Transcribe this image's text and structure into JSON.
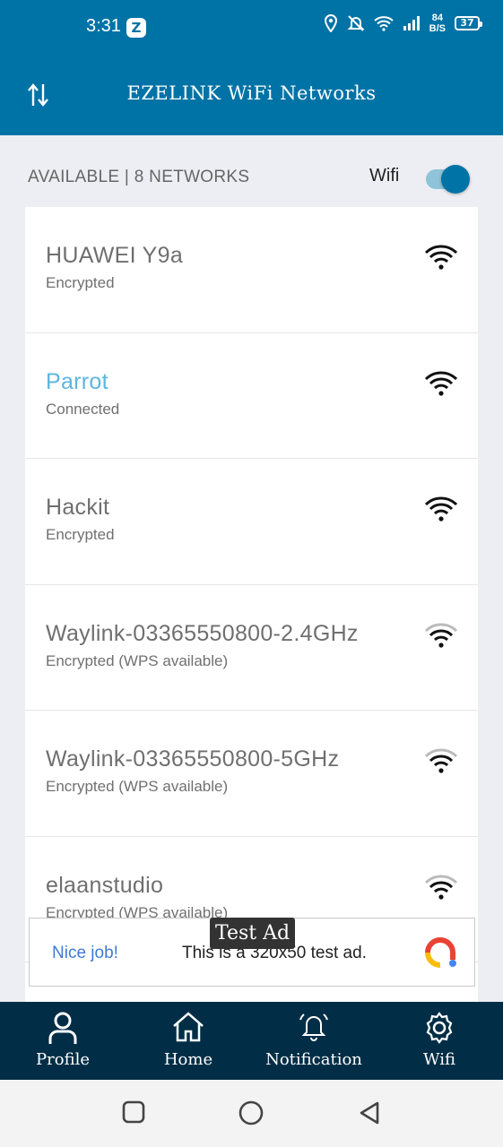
{
  "status_bar": {
    "time": "3:31",
    "app_badge": "Z",
    "speed_value": "84",
    "speed_unit": "B/S",
    "battery": "37"
  },
  "app_bar": {
    "title": "EZELINK WiFi Networks"
  },
  "header": {
    "available_text": "AVAILABLE | 8 NETWORKS",
    "wifi_label": "Wifi",
    "wifi_on": true
  },
  "networks": [
    {
      "name": "HUAWEI Y9a",
      "status": "Encrypted",
      "connected": false,
      "signal_level": 4
    },
    {
      "name": "Parrot",
      "status": "Connected",
      "connected": true,
      "signal_level": 4
    },
    {
      "name": "Hackit",
      "status": "Encrypted",
      "connected": false,
      "signal_level": 4
    },
    {
      "name": "Waylink-03365550800-2.4GHz",
      "status": "Encrypted (WPS available)",
      "connected": false,
      "signal_level": 3
    },
    {
      "name": "Waylink-03365550800-5GHz",
      "status": "Encrypted (WPS available)",
      "connected": false,
      "signal_level": 3
    },
    {
      "name": "elaanstudio",
      "status": "Encrypted (WPS available)",
      "connected": false,
      "signal_level": 3
    }
  ],
  "ad": {
    "badge": "Test Ad",
    "left_text": "Nice job!",
    "message": "This is a 320x50 test ad."
  },
  "bottom_nav": {
    "items": [
      {
        "label": "Profile",
        "icon": "person-icon"
      },
      {
        "label": "Home",
        "icon": "home-icon"
      },
      {
        "label": "Notification",
        "icon": "bell-icon"
      },
      {
        "label": "Wifi",
        "icon": "gear-icon"
      }
    ]
  },
  "colors": {
    "primary": "#0073a6",
    "nav_background": "#012e46",
    "connected_text": "#5ab6df"
  }
}
